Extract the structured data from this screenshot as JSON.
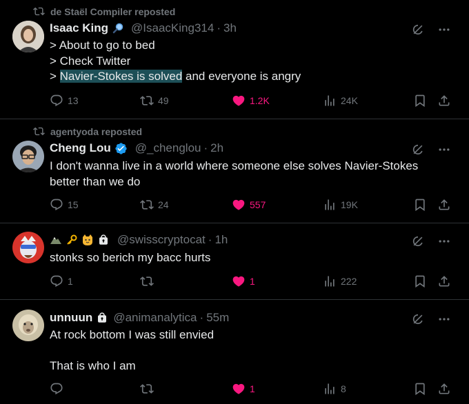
{
  "tweets": [
    {
      "repost_label": "de Staël Compiler reposted",
      "name": "Isaac King",
      "handle": "@IsaacKing314",
      "time": "3h",
      "lines": [
        "> About to go to bed",
        "> Check Twitter"
      ],
      "line3_highlight": "Navier-Stokes is solved",
      "line3_prefix": "> ",
      "line3_suffix": " and everyone is angry",
      "replies": "13",
      "reposts": "49",
      "likes": "1.2K",
      "views": "24K"
    },
    {
      "repost_label": "agentyoda reposted",
      "name": "Cheng Lou",
      "handle": "@_chenglou",
      "time": "2h",
      "text": "I don't wanna live in a world where someone else solves Navier-Stokes better than we do",
      "replies": "15",
      "reposts": "24",
      "likes": "557",
      "views": "19K"
    },
    {
      "handle": "@swisscryptocat",
      "time": "1h",
      "text": "stonks so berich my bacc hurts",
      "replies": "1",
      "reposts": "",
      "likes": "1",
      "views": "222"
    },
    {
      "name": "unnuun",
      "handle": "@animanalytica",
      "time": "55m",
      "text1": "At rock bottom I was still envied",
      "text2": "That is who I am",
      "replies": "",
      "reposts": "",
      "likes": "1",
      "views": "8"
    }
  ],
  "colors": {
    "accent_like": "#f91880",
    "muted": "#71767b",
    "highlight": "#1d4f57",
    "verified": "#1d9bf0"
  }
}
